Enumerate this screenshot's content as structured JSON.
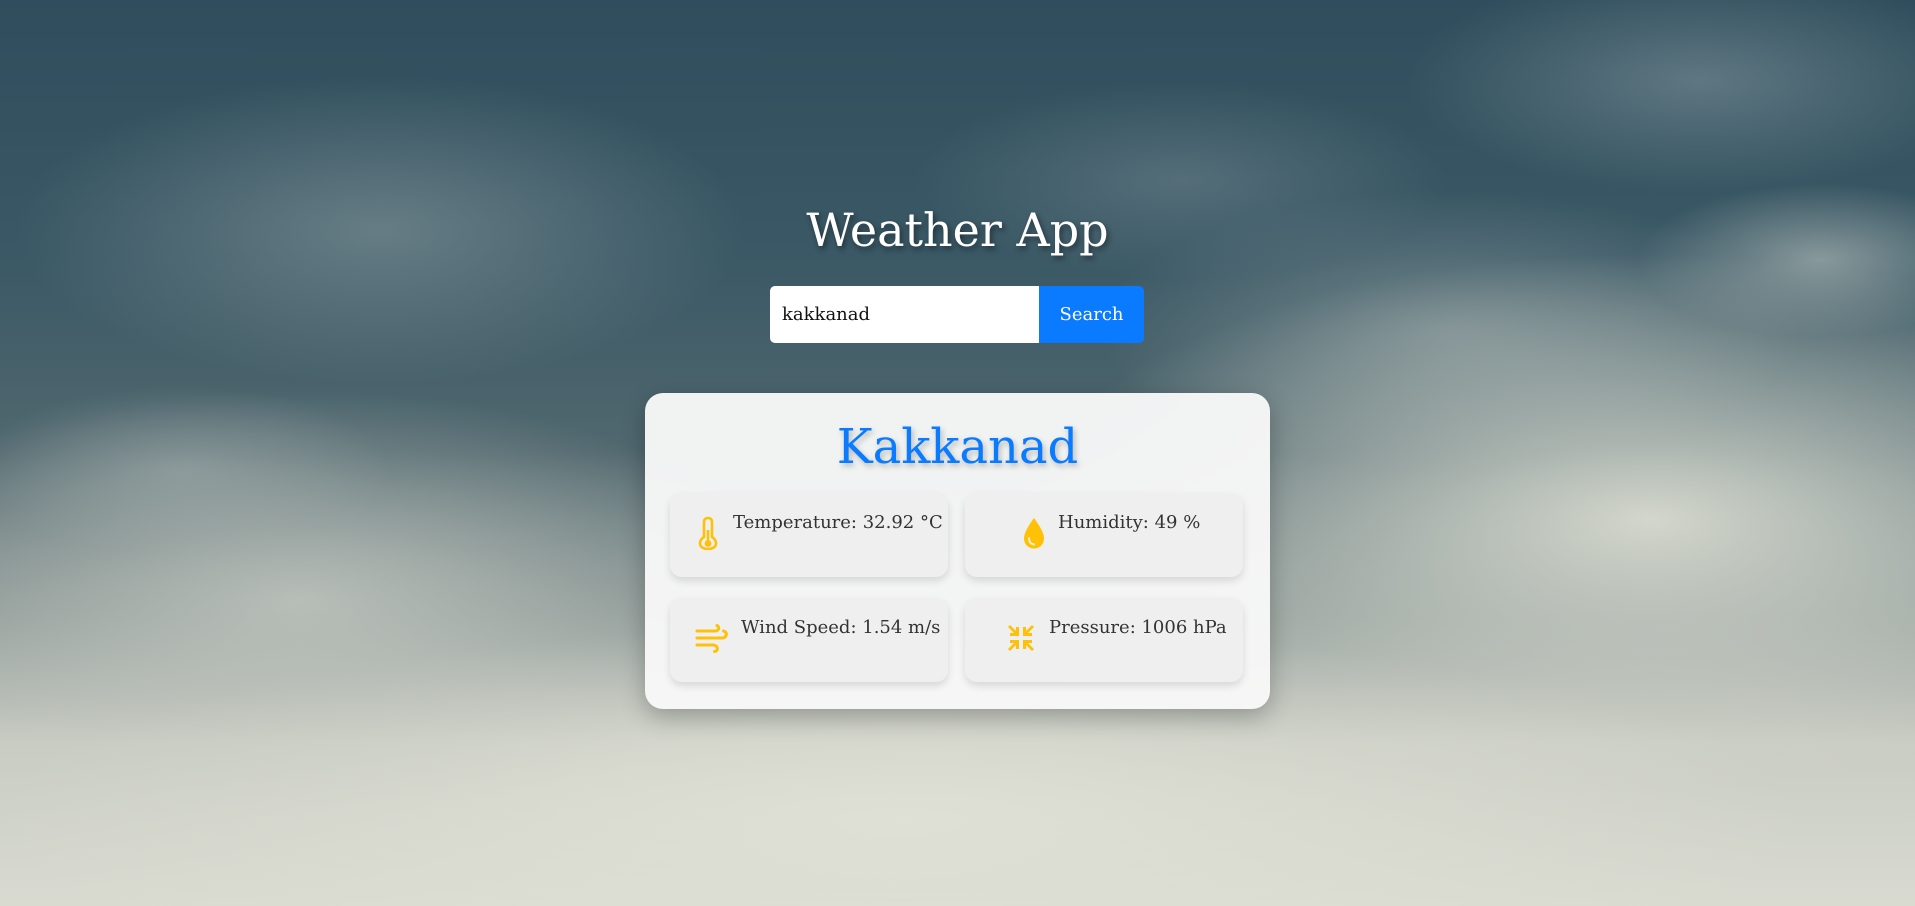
{
  "app": {
    "title": "Weather App"
  },
  "search": {
    "value": "kakkanad",
    "button_label": "Search"
  },
  "weather": {
    "city": "Kakkanad",
    "temperature_label": "Temperature: 32.92 °C",
    "humidity_label": "Humidity: 49 %",
    "wind_label": "Wind Speed: 1.54 m/s",
    "pressure_label": "Pressure: 1006 hPa"
  },
  "icons": {
    "temperature": "thermometer-icon",
    "humidity": "water-drop-icon",
    "wind": "wind-icon",
    "pressure": "compress-arrows-icon"
  },
  "colors": {
    "accent": "#0a7bff",
    "icon": "#ffc107",
    "tile": "#efefef"
  }
}
